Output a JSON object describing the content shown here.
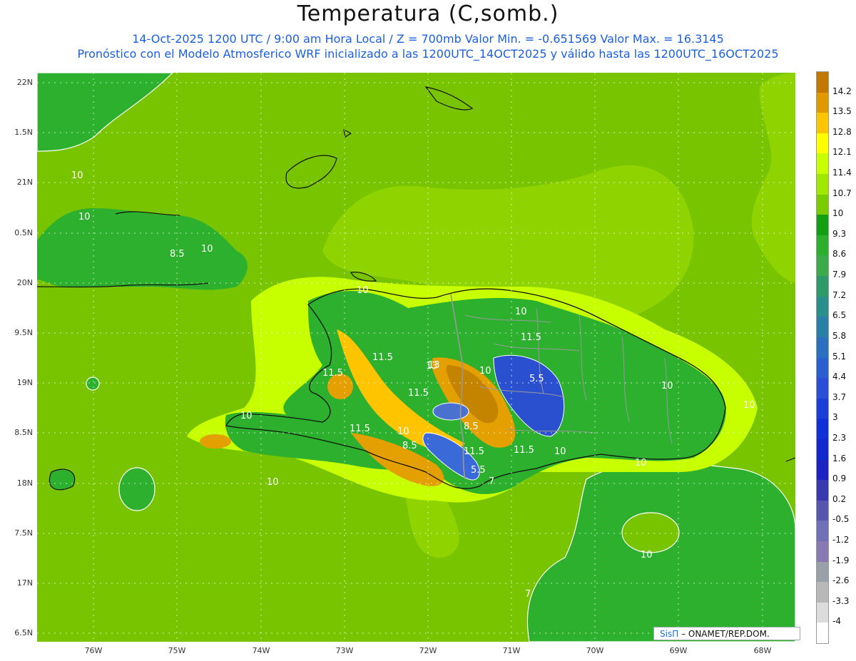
{
  "title": "Temperatura (C,somb.)",
  "subtitle1": "14-Oct-2025   1200 UTC / 9:00 am Hora Local / Z = 700mb   Valor Min. = -0.651569   Valor Max. = 16.3145",
  "subtitle2": "Pronóstico con el Modelo Atmosferico WRF inicializado a las 1200UTC_14OCT2025 y válido hasta las  1200UTC_16OCT2025",
  "lat_labels": [
    "22N",
    "1.5N",
    "21N",
    "0.5N",
    "20N",
    "9.5N",
    "19N",
    "8.5N",
    "18N",
    "7.5N",
    "17N",
    "6.5N"
  ],
  "lon_labels": [
    "76W",
    "75W",
    "74W",
    "73W",
    "72W",
    "71W",
    "70W",
    "69W",
    "68W"
  ],
  "contour_labels": [
    "10",
    "10",
    "8.5",
    "10",
    "10",
    "10",
    "11.5",
    "10",
    "11.5",
    "11.5",
    "13",
    "10",
    "5.5",
    "11.5",
    "8.5",
    "11.5",
    "10",
    "8.5",
    "11.5",
    "11.5",
    "10",
    "10",
    "10",
    "10",
    "10",
    "10",
    "7",
    "13",
    "5.5",
    "7"
  ],
  "colorbar": {
    "labels": [
      "14.2",
      "13.5",
      "12.8",
      "12.1",
      "11.4",
      "10.7",
      "10",
      "9.3",
      "8.6",
      "7.9",
      "7.2",
      "6.5",
      "5.8",
      "5.1",
      "4.4",
      "3.7",
      "3",
      "2.3",
      "1.6",
      "0.9",
      "0.2",
      "-0.5",
      "-1.2",
      "-1.9",
      "-2.6",
      "-3.3",
      "-4"
    ],
    "colors": [
      "#c07800",
      "#e09a00",
      "#ffc400",
      "#ffff00",
      "#c8ff00",
      "#a0e800",
      "#78cc00",
      "#12a012",
      "#2cb02c",
      "#3aaa4a",
      "#2e9a6a",
      "#2a8f8a",
      "#2a7fa8",
      "#2a6fc0",
      "#2a5fd0",
      "#2a4fd6",
      "#1a3ed8",
      "#1030d8",
      "#1028cc",
      "#1e22c0",
      "#3a3ab0",
      "#5656b0",
      "#7070b8",
      "#8878b4",
      "#9aa0a8",
      "#b8b8b8",
      "#dcdcdc",
      "#ffffff"
    ]
  },
  "credit": {
    "logo": "SisΠ",
    "text": "– ONAMET/REP.DOM."
  },
  "colors": {
    "sea": "#78c400",
    "warm_plateau": "#8fd400",
    "land_green": "#2bb02b",
    "orange": "#e4a000",
    "brown": "#c48400",
    "blue": "#2a50d0"
  }
}
